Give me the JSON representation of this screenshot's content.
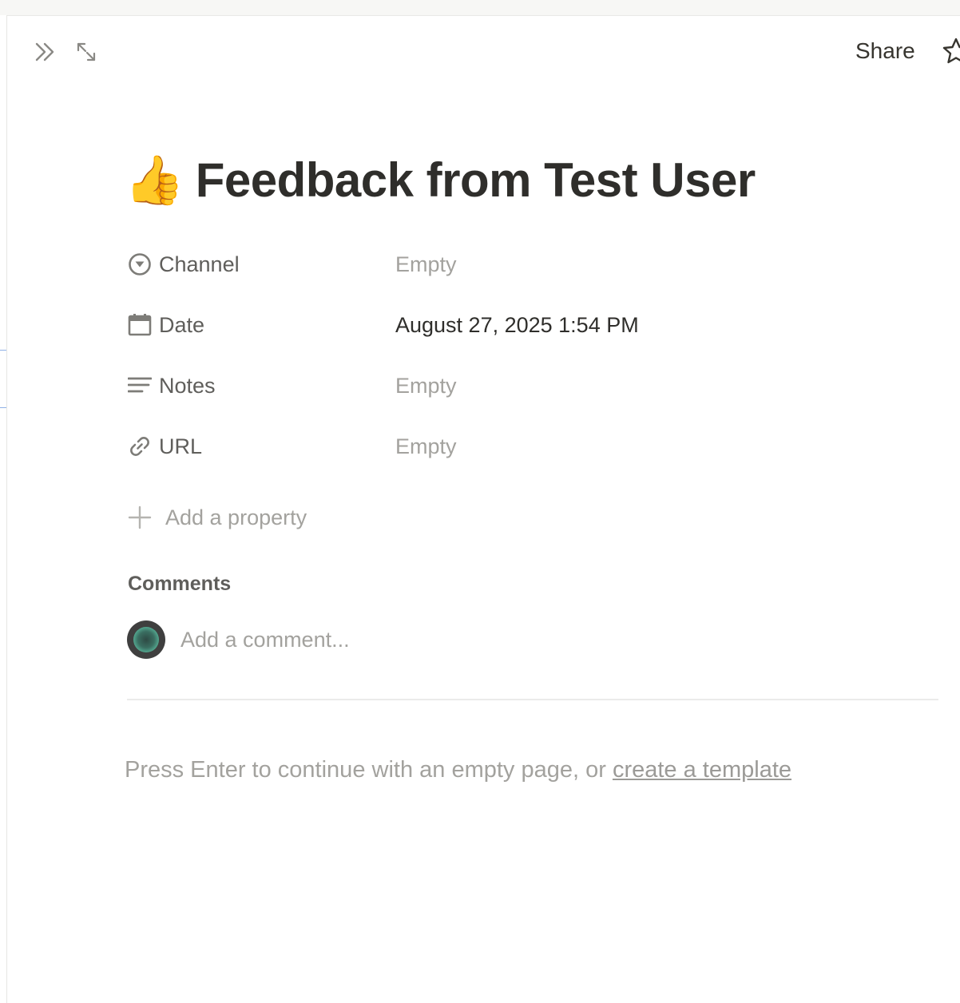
{
  "header": {
    "share_label": "Share"
  },
  "page": {
    "emoji": "👍",
    "title": "Feedback from Test User"
  },
  "properties": [
    {
      "label": "Channel",
      "value": "Empty",
      "icon": "select-circle-icon"
    },
    {
      "label": "Date",
      "value": "August 27, 2025 1:54 PM",
      "icon": "calendar-icon"
    },
    {
      "label": "Notes",
      "value": "Empty",
      "icon": "text-lines-icon"
    },
    {
      "label": "URL",
      "value": "Empty",
      "icon": "link-icon"
    }
  ],
  "add_property_label": "Add a property",
  "comments": {
    "heading": "Comments",
    "placeholder": "Add a comment..."
  },
  "empty_hint": {
    "text": "Press Enter to continue with an empty page, or ",
    "link": "create a template"
  },
  "colors": {
    "accent_avatar": "#6fe6c2",
    "text_primary": "#2f2e2b",
    "text_muted": "#a3a29e"
  }
}
